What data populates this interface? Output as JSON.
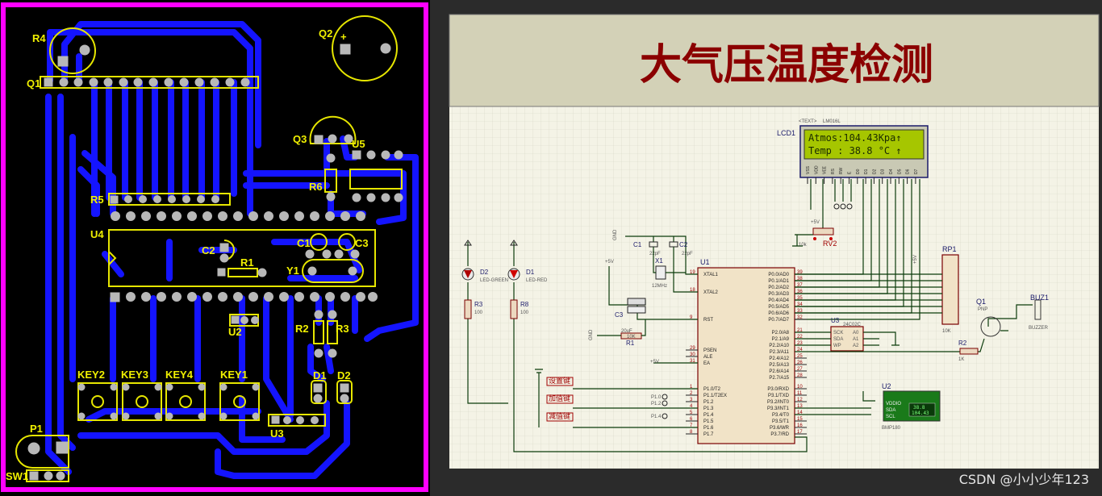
{
  "schematic": {
    "title": "大气压温度检测",
    "lcd": {
      "ref": "LCD1",
      "part": "LM016L",
      "line1": "Atmos:104.43Kpa↑",
      "line2": "Temp : 38.8 °C ↑",
      "pins": [
        "VSS",
        "VDD",
        "VEE",
        "RS",
        "RW",
        "E",
        "D0",
        "D1",
        "D2",
        "D3",
        "D4",
        "D5",
        "D6",
        "D7"
      ]
    },
    "mcu": {
      "ref": "U1",
      "left_pins": [
        "XTAL1",
        "XTAL2",
        "RST",
        "PSEN",
        "ALE",
        "EA",
        "P1.0/T2",
        "P1.1/T2EX",
        "P1.2",
        "P1.3",
        "P1.4",
        "P1.5",
        "P1.6",
        "P1.7"
      ],
      "left_nums": [
        "19",
        "18",
        "9",
        "29",
        "30",
        "31",
        "1",
        "2",
        "3",
        "4",
        "5",
        "6",
        "7",
        "8"
      ],
      "right_pins": [
        "P0.0/AD0",
        "P0.1/AD1",
        "P0.2/AD2",
        "P0.3/AD3",
        "P0.4/AD4",
        "P0.5/AD5",
        "P0.6/AD6",
        "P0.7/AD7",
        "P2.0/A8",
        "P2.1/A9",
        "P2.2/A10",
        "P2.3/A11",
        "P2.4/A12",
        "P2.5/A13",
        "P2.6/A14",
        "P2.7/A15",
        "P3.0/RXD",
        "P3.1/TXD",
        "P3.2/INT0",
        "P3.3/INT1",
        "P3.4/T0",
        "P3.5/T1",
        "P3.6/WR",
        "P3.7/RD"
      ],
      "right_nums": [
        "39",
        "38",
        "37",
        "36",
        "35",
        "34",
        "33",
        "32",
        "21",
        "22",
        "23",
        "24",
        "25",
        "26",
        "27",
        "28",
        "10",
        "11",
        "12",
        "13",
        "14",
        "15",
        "16",
        "17"
      ]
    },
    "components": {
      "d2": "D2",
      "d2_part": "LED-GREEN",
      "d1": "D1",
      "d1_part": "LED-RED",
      "r3": "R3",
      "r3_val": "100",
      "r8": "R8",
      "r8_val": "100",
      "c1": "C1",
      "c1_val": "22pF",
      "c2": "C2",
      "c2_val": "22pF",
      "x1": "X1",
      "x1_val": "12MHz",
      "c3": "C3",
      "c3_val": "20uF",
      "r1": "R1",
      "r1_val": "10K",
      "rv2": "RV2",
      "rv2_val": "10k",
      "rp1": "RP1",
      "rp1_val": "10K",
      "q1": "Q1",
      "q1_part": "PNP",
      "r2": "R2",
      "r2_val": "1K",
      "buz": "BUZ1",
      "buz_part": "BUZZER",
      "u3": "U3",
      "u3_part": "24C02C",
      "u3_pins_left": [
        "SCK",
        "SDA",
        "WP"
      ],
      "u3_pins_right": [
        "A0",
        "A1",
        "A2"
      ],
      "u2": "U2",
      "u2_part": "BMP180",
      "u2_pins": [
        "VDDIO",
        "SDA",
        "SCL"
      ],
      "u2_display_top": "38.8",
      "u2_display_bottom": "104.43",
      "btn1": "设置键",
      "btn2": "加值键",
      "btn3": "减值键",
      "p10": "P1.0",
      "p12": "P1.2",
      "p14": "P1.4",
      "p11": "P1.1",
      "p12b": "P1.2",
      "p13": "P1.3",
      "vcc": "+5V",
      "gnd": "GND",
      "text_tag": "<TEXT>"
    },
    "watermark": "CSDN @小小少年123"
  },
  "pcb": {
    "labels": {
      "r4": "R4",
      "q2": "Q2",
      "q1": "Q1",
      "q3": "Q3",
      "u5": "U5",
      "r6": "R6",
      "r5": "R5",
      "u4": "U4",
      "c2": "C2",
      "r1": "R1",
      "c1": "C1",
      "c3": "C3",
      "y1": "Y1",
      "u2": "U2",
      "r2": "R2",
      "r3": "R3",
      "d1": "D1",
      "d2": "D2",
      "key2": "KEY2",
      "key3": "KEY3",
      "key4": "KEY4",
      "key1": "KEY1",
      "u3": "U3",
      "p1": "P1",
      "sw1": "SW1",
      "plus": "+"
    }
  }
}
